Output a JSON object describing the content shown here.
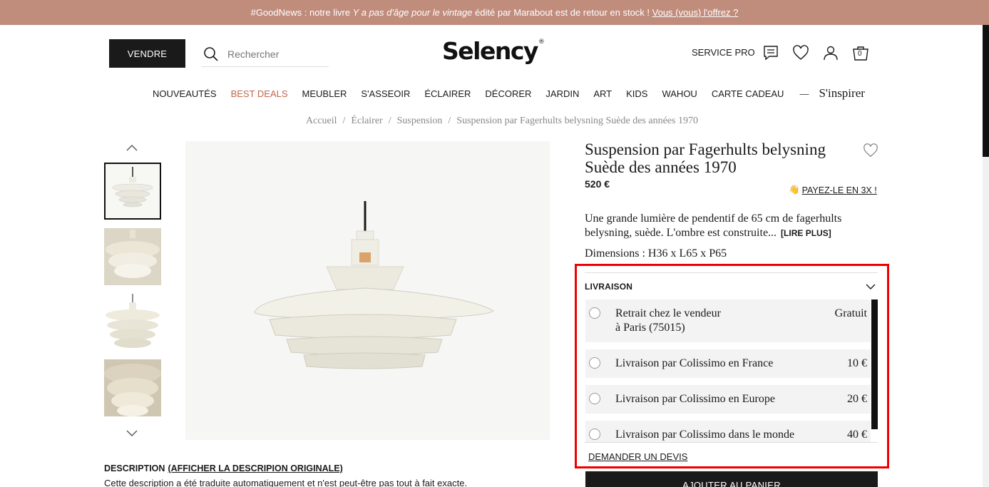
{
  "banner": {
    "prefix": "#GoodNews : notre livre ",
    "book_title": "Y a pas d'âge pour le vintage",
    "suffix": " édité par Marabout est de retour en stock ! ",
    "link": "Vous (vous) l'offrez ?"
  },
  "header": {
    "sell_label": "VENDRE",
    "search_placeholder": "Rechercher",
    "logo_text": "Selency",
    "logo_mark": "®",
    "service_pro": "SERVICE PRO",
    "cart_count": "0",
    "icons": [
      "search-icon",
      "chat-icon",
      "heart-icon",
      "user-icon",
      "basket-icon"
    ]
  },
  "nav": {
    "items": [
      "NOUVEAUTÉS",
      "BEST DEALS",
      "MEUBLER",
      "S'ASSEOIR",
      "ÉCLAIRER",
      "DÉCORER",
      "JARDIN",
      "ART",
      "KIDS",
      "WAHOU",
      "CARTE CADEAU"
    ],
    "dash": "—",
    "inspire": "S'inspirer",
    "accent_color": "#c0654a"
  },
  "breadcrumb": {
    "items": [
      "Accueil",
      "Éclairer",
      "Suspension",
      "Suspension par Fagerhults belysning Suède des années 1970"
    ],
    "separator": "/"
  },
  "product": {
    "title": "Suspension par Fagerhults belysning Suède des années 1970",
    "price": "520 €",
    "pay_emoji": "👋",
    "pay_label": "PAYEZ-LE EN 3X !",
    "description": "Une grande lumière de pendentif de 65 cm de fagerhults belysning, suède. L'ombre est construite...",
    "read_more": "[LIRE PLUS]",
    "dimensions": "Dimensions : H36 x L65 x P65"
  },
  "livraison": {
    "title": "LIVRAISON",
    "options": [
      {
        "label_line1": "Retrait chez le vendeur",
        "label_line2": "à Paris (75015)",
        "price": "Gratuit"
      },
      {
        "label_line1": "Livraison par Colissimo en France",
        "label_line2": "",
        "price": "10 €"
      },
      {
        "label_line1": "Livraison par Colissimo en Europe",
        "label_line2": "",
        "price": "20 €"
      },
      {
        "label_line1": "Livraison par Colissimo dans le monde",
        "label_line2": "",
        "price": "40 €"
      }
    ],
    "quote_link": "DEMANDER UN DEVIS",
    "add_to_cart": "AJOUTER AU PANIER"
  },
  "description_section": {
    "heading": "DESCRIPTION",
    "original_link": "(AFFICHER LA DESCRIPION ORIGINALE)",
    "note": "Cette description a été traduite automatiquement et n'est peut-être pas tout à fait exacte."
  },
  "colors": {
    "banner": "#c08c7b",
    "highlight": "#e00000",
    "dark": "#1a1a1a"
  }
}
